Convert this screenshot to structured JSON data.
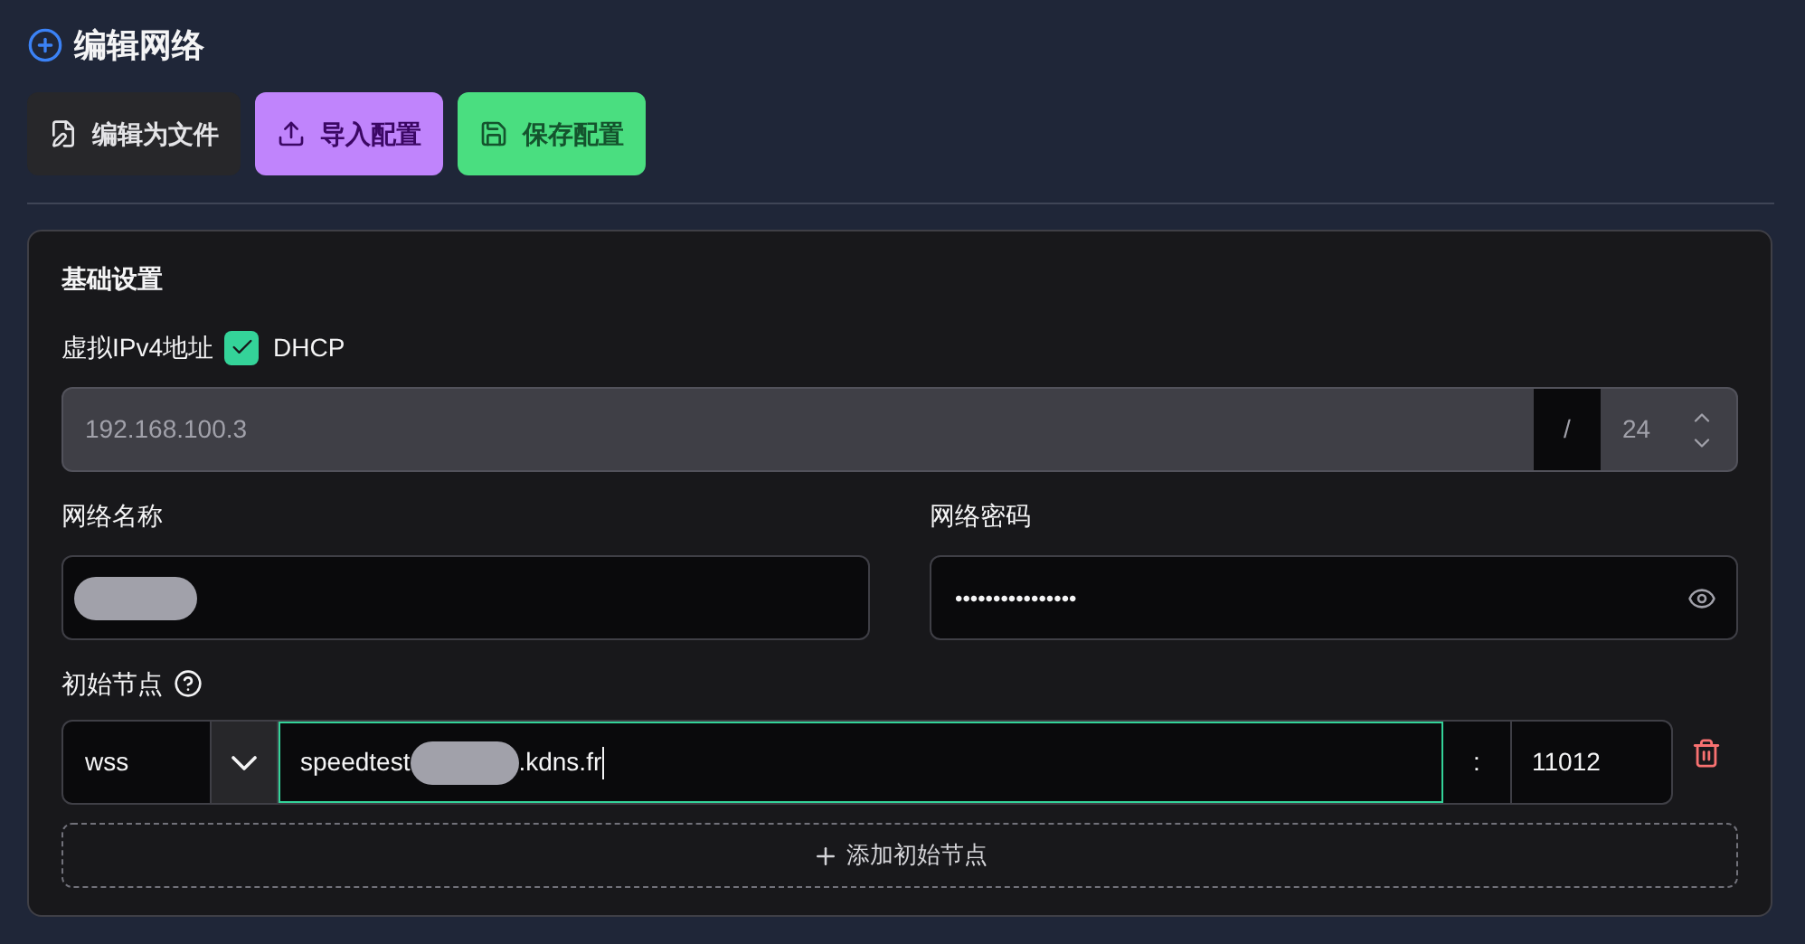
{
  "title": "编辑网络",
  "toolbar": [
    {
      "kind": "edit",
      "label": "编辑为文件"
    },
    {
      "kind": "import",
      "label": "导入配置"
    },
    {
      "kind": "save",
      "label": "保存配置"
    }
  ],
  "section": {
    "title": "基础设置",
    "ipv4": {
      "label": "虚拟IPv4地址",
      "dhcp": {
        "label": "DHCP",
        "checked": true
      },
      "address": "192.168.100.3",
      "separator": "/",
      "prefix": "24",
      "disabled": true
    },
    "network_name": {
      "label": "网络名称",
      "redacted": true
    },
    "network_secret": {
      "label": "网络密码",
      "value": "••••••••••••••••"
    },
    "peers": {
      "label": "初始节点",
      "items": [
        {
          "protocol": "wss",
          "url_start": "speedtest",
          "redacted": true,
          "url_end": ".kdns.fr",
          "separator": ":",
          "port": "11012",
          "focused": true
        }
      ],
      "add_label": "添加初始节点"
    }
  }
}
